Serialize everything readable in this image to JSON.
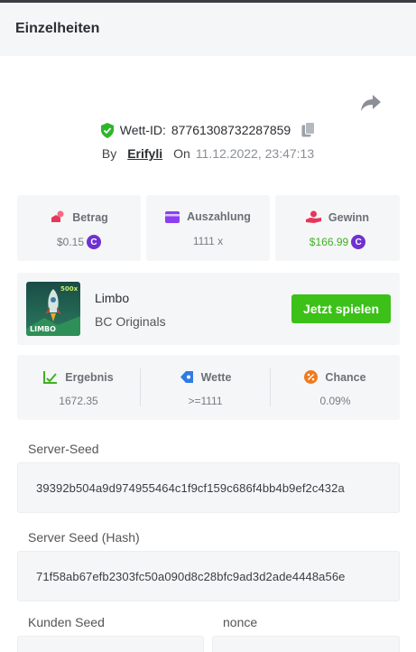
{
  "header": {
    "title": "Einzelheiten"
  },
  "bet": {
    "id_label": "Wett-ID:",
    "id": "87761308732287859",
    "by_label": "By",
    "user": "Erifyli",
    "on_label": "On",
    "date": "11.12.2022, 23:47:13"
  },
  "stats": {
    "amount_label": "Betrag",
    "amount_value": "$0.15",
    "payout_label": "Auszahlung",
    "payout_value": "1111 x",
    "profit_label": "Gewinn",
    "profit_value": "$166.99",
    "coin_symbol": "C"
  },
  "game": {
    "name": "Limbo",
    "provider": "BC Originals",
    "thumb_text": "LIMBO",
    "thumb_badge": "500x",
    "play_label": "Jetzt spielen"
  },
  "result": {
    "result_label": "Ergebnis",
    "result_value": "1672.35",
    "bet_label": "Wette",
    "bet_value": ">=1111",
    "chance_label": "Chance",
    "chance_value": "0.09%"
  },
  "seeds": {
    "server_seed_label": "Server-Seed",
    "server_seed": "39392b504a9d974955464c1f9cf159c686f4bb4b9ef2c432a",
    "server_hash_label": "Server Seed (Hash)",
    "server_hash": "71f58ab67efb2303fc50a090d8c28bfc9ad3d2ade4448a56e",
    "client_seed_label": "Kunden Seed",
    "nonce_label": "nonce"
  },
  "colors": {
    "accent_green": "#3bc117",
    "coin_purple": "#6f31cf",
    "card_bg": "#f5f6f7"
  }
}
